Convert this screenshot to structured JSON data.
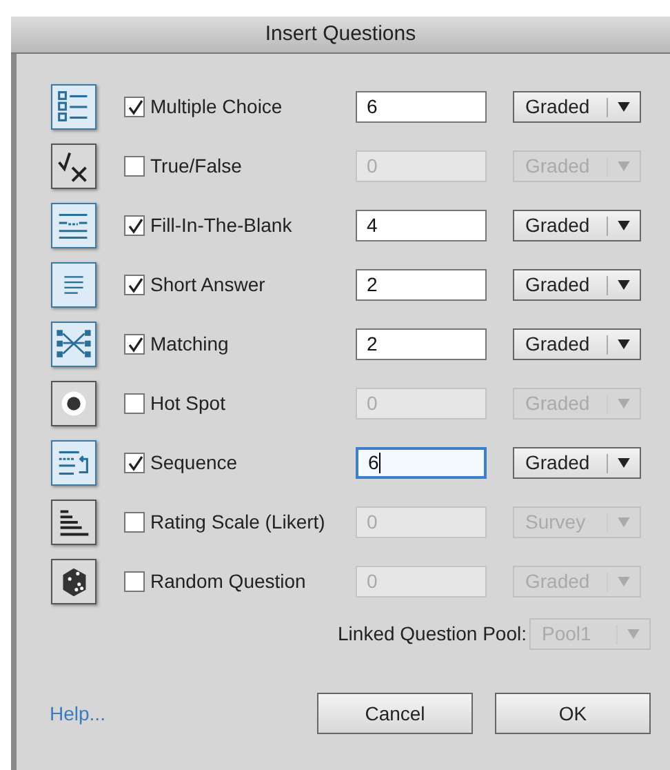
{
  "window": {
    "title": "Insert Questions"
  },
  "questions": [
    {
      "label": "Multiple Choice",
      "checked": true,
      "count": "6",
      "focused": false,
      "mode": "Graded"
    },
    {
      "label": "True/False",
      "checked": false,
      "count": "0",
      "focused": false,
      "mode": "Graded"
    },
    {
      "label": "Fill-In-The-Blank",
      "checked": true,
      "count": "4",
      "focused": false,
      "mode": "Graded"
    },
    {
      "label": "Short Answer",
      "checked": true,
      "count": "2",
      "focused": false,
      "mode": "Graded"
    },
    {
      "label": "Matching",
      "checked": true,
      "count": "2",
      "focused": false,
      "mode": "Graded"
    },
    {
      "label": "Hot Spot",
      "checked": false,
      "count": "0",
      "focused": false,
      "mode": "Graded"
    },
    {
      "label": "Sequence",
      "checked": true,
      "count": "6",
      "focused": true,
      "mode": "Graded"
    },
    {
      "label": "Rating Scale (Likert)",
      "checked": false,
      "count": "0",
      "focused": false,
      "mode": "Survey"
    },
    {
      "label": "Random Question",
      "checked": false,
      "count": "0",
      "focused": false,
      "mode": "Graded"
    }
  ],
  "pool": {
    "label": "Linked Question Pool:",
    "value": "Pool1",
    "disabled": true
  },
  "help_link": "Help...",
  "buttons": [
    "Cancel",
    "OK"
  ]
}
